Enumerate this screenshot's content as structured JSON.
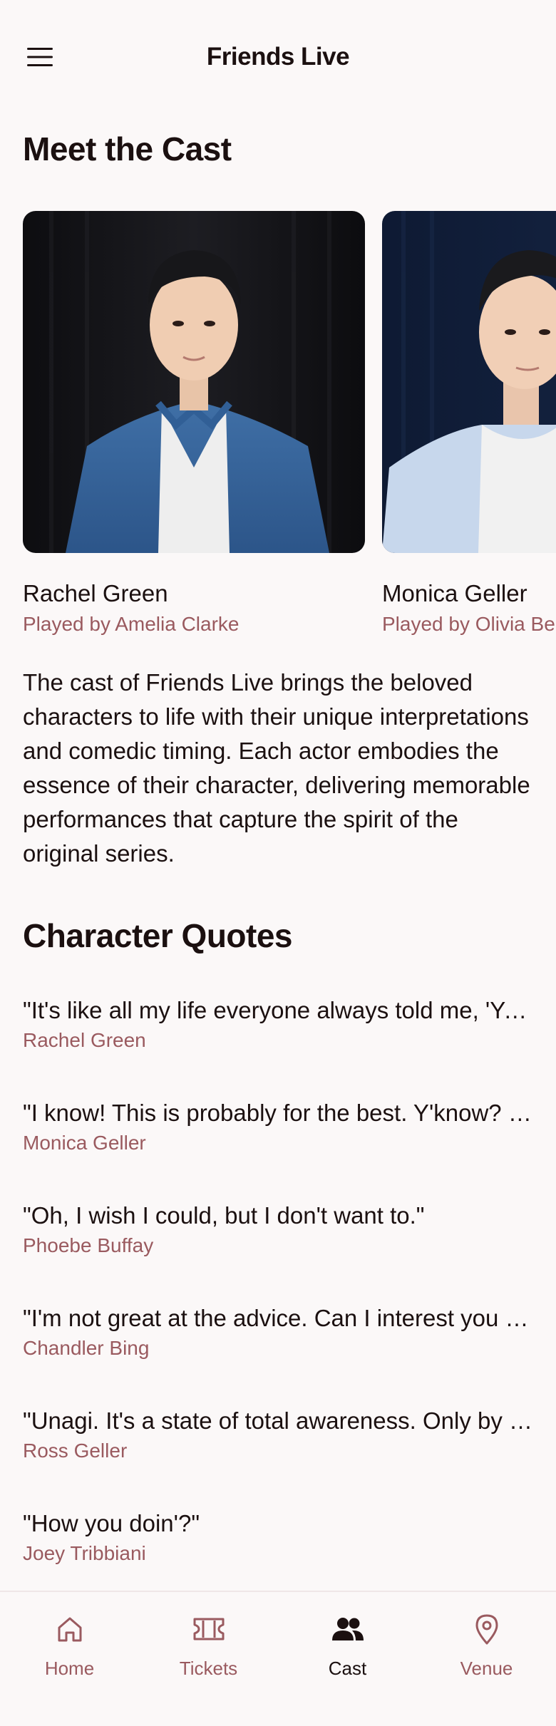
{
  "header": {
    "title": "Friends Live",
    "menu_icon": "menu-icon"
  },
  "cast_section": {
    "title": "Meet the Cast",
    "members": [
      {
        "name": "Rachel Green",
        "actor": "Played by Amelia Clarke"
      },
      {
        "name": "Monica Geller",
        "actor": "Played by Olivia Bennett"
      }
    ],
    "description": "The cast of Friends Live brings the beloved characters to life with their unique interpretations and comedic timing. Each actor embodies the essence of their character, delivering memorable performances that capture the spirit of the original series."
  },
  "quotes_section": {
    "title": "Character Quotes",
    "quotes": [
      {
        "text": "\"It's like all my life everyone always told me, 'You're a shoe!'\"",
        "author": "Rachel Green"
      },
      {
        "text": "\"I know! This is probably for the best. Y'know? Independence.\"",
        "author": "Monica Geller"
      },
      {
        "text": "\"Oh, I wish I could, but I don't want to.\"",
        "author": "Phoebe Buffay"
      },
      {
        "text": "\"I'm not great at the advice. Can I interest you in a sarcastic comment?\"",
        "author": "Chandler Bing"
      },
      {
        "text": "\"Unagi. It's a state of total awareness. Only by achieving true unagi...\"",
        "author": "Ross Geller"
      },
      {
        "text": "\"How you doin'?\"",
        "author": "Joey Tribbiani"
      }
    ]
  },
  "bottom_nav": {
    "items": [
      {
        "label": "Home",
        "icon": "home-icon",
        "active": false
      },
      {
        "label": "Tickets",
        "icon": "ticket-icon",
        "active": false
      },
      {
        "label": "Cast",
        "icon": "people-icon",
        "active": true
      },
      {
        "label": "Venue",
        "icon": "location-pin-icon",
        "active": false
      }
    ]
  },
  "colors": {
    "accent": "#9a5a5f",
    "text": "#1b1010",
    "background": "#fbf8f8"
  }
}
